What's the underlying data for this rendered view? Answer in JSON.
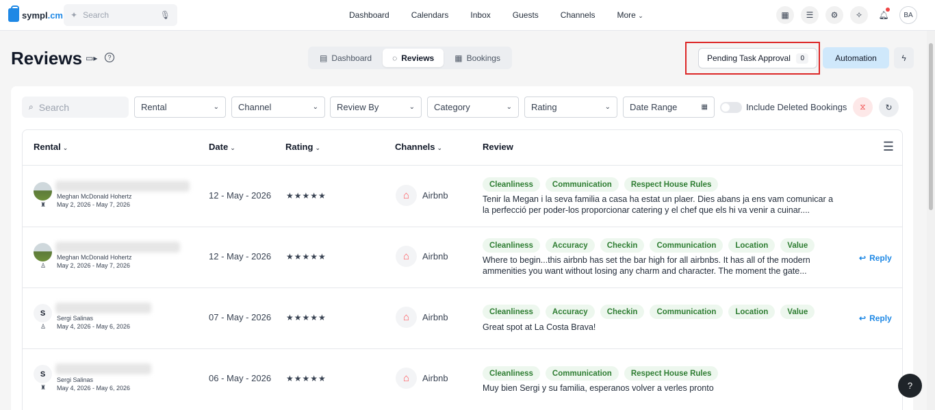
{
  "topbar": {
    "logo": {
      "name_main": "sympl",
      "name_suffix": ".cm"
    },
    "search_placeholder": "Search",
    "nav": [
      "Dashboard",
      "Calendars",
      "Inbox",
      "Guests",
      "Channels",
      "More"
    ],
    "user_initials": "BA"
  },
  "header": {
    "title": "Reviews",
    "tabs": [
      {
        "label": "Dashboard",
        "icon": "dashboard-icon"
      },
      {
        "label": "Reviews",
        "icon": "chat-icon",
        "active": true
      },
      {
        "label": "Bookings",
        "icon": "calendar-icon"
      }
    ],
    "pending_label": "Pending Task Approval",
    "pending_count": "0",
    "automation_label": "Automation"
  },
  "filters": {
    "search_placeholder": "Search",
    "selects": [
      "Rental",
      "Channel",
      "Review By",
      "Category",
      "Rating",
      "Date Range"
    ],
    "toggle_label": "Include Deleted Bookings"
  },
  "table": {
    "columns": [
      "Rental",
      "Date",
      "Rating",
      "Channels",
      "Review"
    ],
    "rows": [
      {
        "avatar": "photo",
        "rental_name": "",
        "guest": "Meghan McDonald Hohertz",
        "stay": "May 2, 2026 - May 7, 2026",
        "date": "12 - May - 2026",
        "stars": "★★★★★",
        "channel": "Airbnb",
        "tags": [
          "Cleanliness",
          "Communication",
          "Respect House Rules"
        ],
        "review": "Tenir la Megan i la seva familia a casa ha estat un plaer. Dies abans ja ens vam comunicar a la perfecció per poder-los proporcionar catering y el chef que els hi va venir a cuinar....",
        "reply": ""
      },
      {
        "avatar": "photo",
        "rental_name": "",
        "guest": "Meghan McDonald Hohertz",
        "stay": "May 2, 2026 - May 7, 2026",
        "date": "12 - May - 2026",
        "stars": "★★★★★",
        "channel": "Airbnb",
        "tags": [
          "Cleanliness",
          "Accuracy",
          "Checkin",
          "Communication",
          "Location",
          "Value"
        ],
        "review": "Where to begin...this airbnb has set the bar high for all airbnbs. It has all of the modern ammenities you want without losing any charm and character. The moment the gate...",
        "reply": "Reply"
      },
      {
        "avatar": "S",
        "rental_name": "",
        "guest": "Sergi Salinas",
        "stay": "May 4, 2026 - May 6, 2026",
        "date": "07 - May - 2026",
        "stars": "★★★★★",
        "channel": "Airbnb",
        "tags": [
          "Cleanliness",
          "Accuracy",
          "Checkin",
          "Communication",
          "Location",
          "Value"
        ],
        "review": "Great spot at La Costa Brava!",
        "reply": "Reply"
      },
      {
        "avatar": "S",
        "rental_name": "",
        "guest": "Sergi Salinas",
        "stay": "May 4, 2026 - May 6, 2026",
        "date": "06 - May - 2026",
        "stars": "★★★★★",
        "channel": "Airbnb",
        "tags": [
          "Cleanliness",
          "Communication",
          "Respect House Rules"
        ],
        "review": "Muy bien Sergi y su familia, esperanos volver a verles pronto",
        "reply": ""
      }
    ]
  },
  "help_label": "?"
}
